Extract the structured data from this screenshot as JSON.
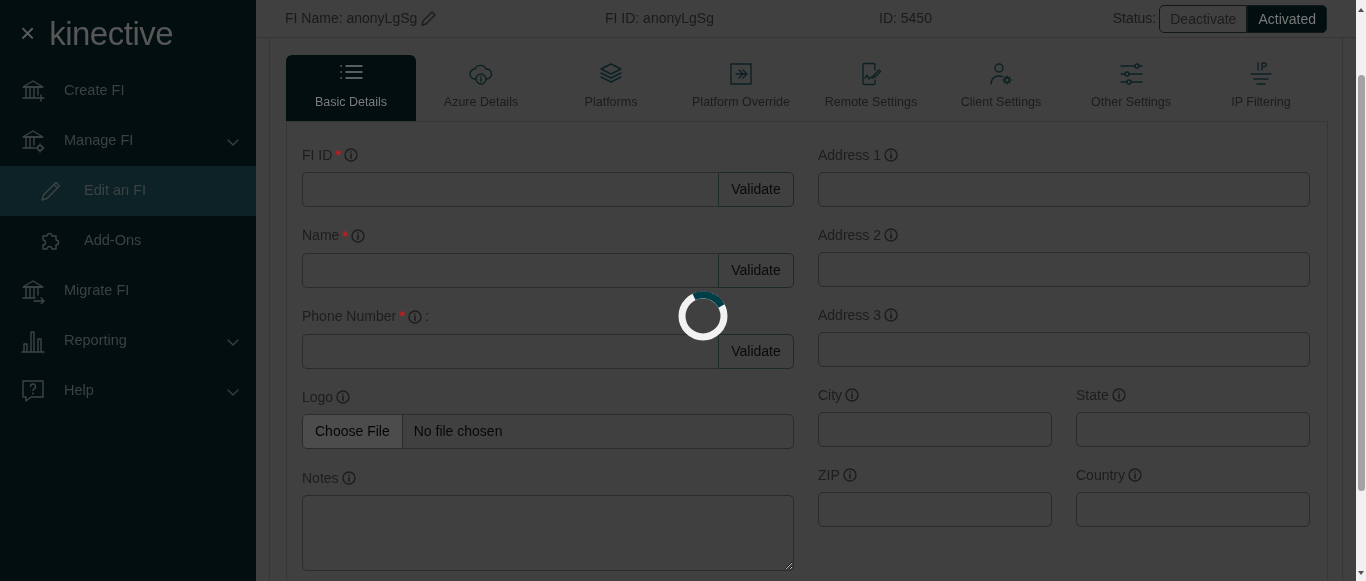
{
  "sidebar": {
    "close": "×",
    "logo": "kinective",
    "items": [
      {
        "label": "Create FI",
        "expandable": false,
        "selected": false
      },
      {
        "label": "Manage FI",
        "expandable": true,
        "selected": false,
        "children": [
          {
            "label": "Edit an FI",
            "selected": true
          },
          {
            "label": "Add-Ons",
            "selected": false
          }
        ]
      },
      {
        "label": "Migrate FI",
        "expandable": false,
        "selected": false
      },
      {
        "label": "Reporting",
        "expandable": true,
        "selected": false
      },
      {
        "label": "Help",
        "expandable": true,
        "selected": false
      }
    ]
  },
  "header": {
    "fi_name": "FI Name: anonyLgSg",
    "fi_id": "FI ID: anonyLgSg",
    "id": "ID: 5450",
    "status_label": "Status:",
    "status_options": [
      {
        "label": "Deactivate",
        "selected": false
      },
      {
        "label": "Activated",
        "selected": true
      }
    ]
  },
  "tabs": [
    {
      "label": "Basic Details",
      "selected": true
    },
    {
      "label": "Azure Details",
      "selected": false
    },
    {
      "label": "Platforms",
      "selected": false
    },
    {
      "label": "Platform Override",
      "selected": false
    },
    {
      "label": "Remote Settings",
      "selected": false
    },
    {
      "label": "Client Settings",
      "selected": false
    },
    {
      "label": "Other Settings",
      "selected": false
    },
    {
      "label": "IP Filtering",
      "selected": false
    }
  ],
  "form": {
    "left": [
      {
        "label": "FI ID",
        "marker": "*",
        "info": true,
        "kind": "validate",
        "button": "Validate"
      },
      {
        "label": "Name",
        "marker": "*",
        "info": true,
        "kind": "validate",
        "button": "Validate"
      },
      {
        "label": "Phone Number",
        "marker": "*",
        "info": true,
        "suffix": ":",
        "kind": "validate",
        "button": "Validate"
      },
      {
        "label": "Logo",
        "info": true,
        "kind": "file",
        "button": "Choose File",
        "value": "No file chosen"
      },
      {
        "label": "Notes",
        "info": true,
        "kind": "textarea"
      }
    ],
    "right": [
      [
        {
          "label": "Address 1",
          "info": true,
          "kind": "text"
        }
      ],
      [
        {
          "label": "Address 2",
          "info": true,
          "kind": "text"
        }
      ],
      [
        {
          "label": "Address 3",
          "info": true,
          "kind": "text"
        }
      ],
      [
        {
          "label": "City",
          "info": true,
          "kind": "text"
        },
        {
          "label": "State",
          "info": true,
          "kind": "text"
        }
      ],
      [
        {
          "label": "ZIP",
          "info": true,
          "kind": "text"
        },
        {
          "label": "Country",
          "info": true,
          "kind": "text"
        }
      ]
    ]
  },
  "loading": true
}
